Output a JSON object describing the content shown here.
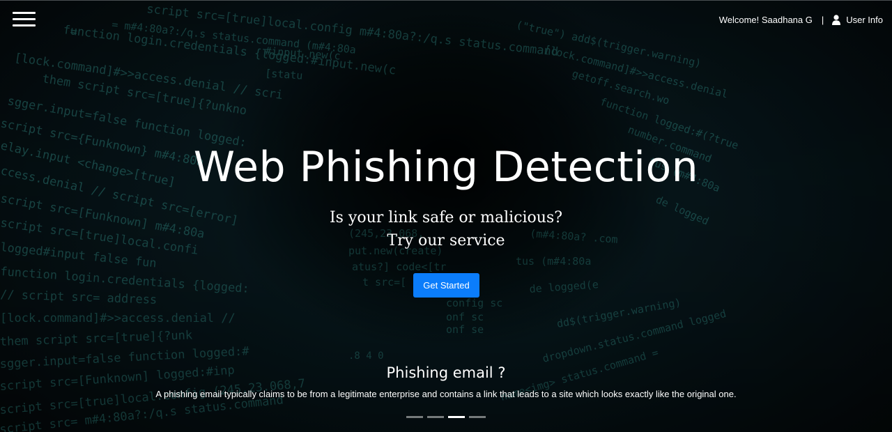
{
  "header": {
    "welcome_text": "Welcome! Saadhana G",
    "separator": "|",
    "user_info_label": "User Info"
  },
  "hero": {
    "title": "Web Phishing Detection",
    "subtitle_line1": "Is your link safe or malicious?",
    "subtitle_line2": "Try our service",
    "cta_label": "Get Started"
  },
  "carousel": {
    "caption_title": "Phishing email ?",
    "caption_text": "A phishing email typically claims to be from a legitimate enterprise and contains a link that leads to a site which looks exactly like the original one.",
    "slide_count": 4,
    "active_index": 2
  },
  "icons": {
    "menu": "hamburger-menu-icon",
    "user": "user-icon"
  },
  "colors": {
    "accent_button": "#0b7dfb",
    "code_text": "#2c7a76",
    "text": "#ffffff"
  }
}
